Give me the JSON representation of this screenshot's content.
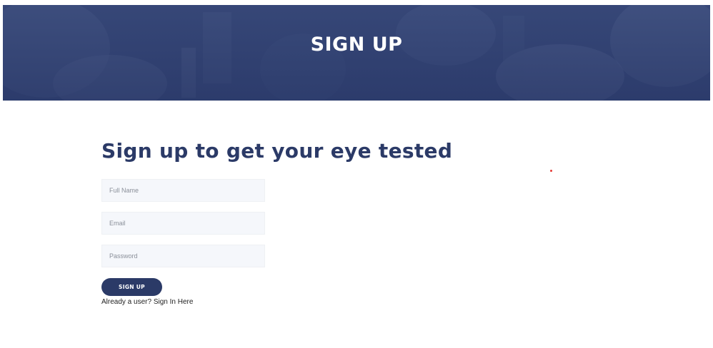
{
  "banner": {
    "title": "SIGN UP"
  },
  "main": {
    "heading": "Sign up to get your eye tested"
  },
  "form": {
    "full_name": {
      "placeholder": "Full Name",
      "value": ""
    },
    "email": {
      "placeholder": "Email",
      "value": ""
    },
    "password": {
      "placeholder": "Password",
      "value": ""
    },
    "submit_label": "SIGN UP"
  },
  "signin": {
    "prompt": "Already a user?",
    "link_label": "Sign In Here"
  },
  "colors": {
    "brand": "#2b3a67",
    "banner": "#3b4d7d",
    "input_bg": "#f5f7fb",
    "accent_dot": "#e53935"
  }
}
